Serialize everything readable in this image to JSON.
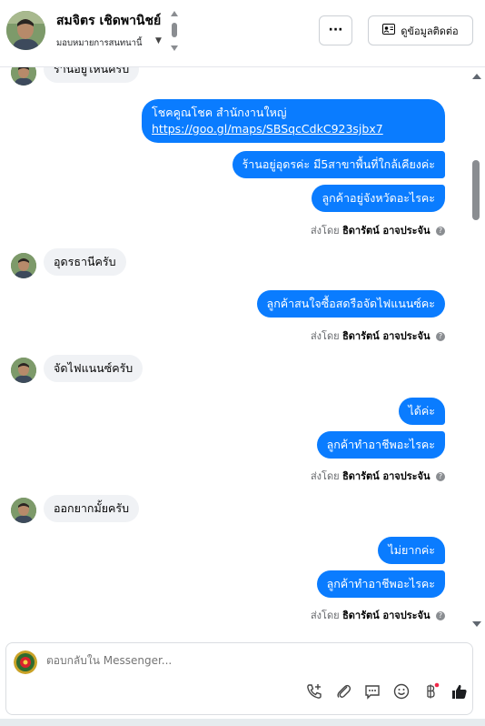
{
  "header": {
    "name": "สมจิตร เชิดพานิชย์",
    "subtitle": "มอบหมายการสนทนานี้",
    "more_label": "···",
    "contact_label": "ดูข้อมูลติดต่อ"
  },
  "messages": {
    "m0": "ร้านอยู่ไหนครับ",
    "m1_line1": "โชคคูณโชค สำนักงานใหญ่",
    "m1_link": "https://goo.gl/maps/SBSqcCdkC923sjbx7",
    "m2": "ร้านอยู่อุดรค่ะ มี5สาขาพื้นที่ใกล้เคียงค่ะ",
    "m3": "ลูกค้าอยู่จังหวัดอะไรคะ",
    "m4": "อุดรธานีครับ",
    "m5": "ลูกค้าสนใจซื้อสดรือจัดไฟแนนซ์คะ",
    "m6": "จัดไฟแนนซ์ครับ",
    "m7": "ได้ค่ะ",
    "m8": "ลูกค้าทำอาชีพอะไรคะ",
    "m9": "ออกยากมั้ยครับ",
    "m10": "ไม่ยากค่ะ",
    "m11": "ลูกค้าทำอาชีพอะไรคะ"
  },
  "sent_by": {
    "prefix": "ส่งโดย",
    "agent": "ธิดารัตน์ อาจประจัน"
  },
  "composer": {
    "placeholder": "ตอบกลับใน Messenger..."
  },
  "colors": {
    "outgoing": "#0a7cff",
    "incoming": "#f0f2f5"
  },
  "icons": [
    "phone-plus-icon",
    "attachment-icon",
    "saved-reply-icon",
    "emoji-icon",
    "baht-icon",
    "like-icon"
  ]
}
